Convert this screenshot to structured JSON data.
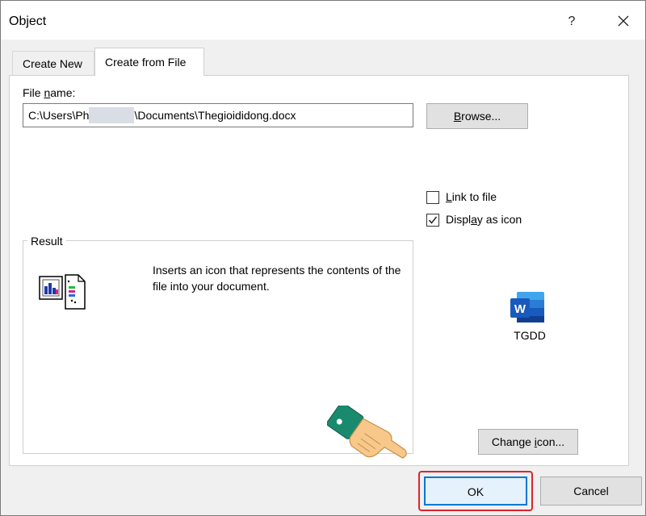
{
  "window": {
    "title": "Object",
    "help": "?",
    "close_icon": "close-icon"
  },
  "tabs": [
    {
      "label": "Create New",
      "active": false
    },
    {
      "label": "Create from File",
      "active": true
    }
  ],
  "file": {
    "label_prefix": "File ",
    "label_key": "n",
    "label_suffix": "ame:",
    "value_start": "C:\\Users\\Ph",
    "value_end": "\\Documents\\Thegioididong.docx"
  },
  "browse": {
    "prefix": "",
    "key": "B",
    "suffix": "rowse..."
  },
  "options": {
    "link": {
      "key": "L",
      "rest": "ink to file",
      "checked": false
    },
    "display": {
      "prefix": "Displ",
      "key": "a",
      "suffix": "y as icon",
      "checked": true
    }
  },
  "result": {
    "legend": "Result",
    "text": "Inserts an icon that represents the contents of the file into your document."
  },
  "icon_preview": {
    "caption": "TGDD",
    "icon": "word-icon"
  },
  "change_icon": {
    "prefix": "Change ",
    "key": "i",
    "suffix": "con..."
  },
  "ok_label": "OK",
  "cancel_label": "Cancel",
  "colors": {
    "highlight": "#d9252f",
    "word_blue": "#185abd",
    "ok_border": "#0078d7"
  }
}
